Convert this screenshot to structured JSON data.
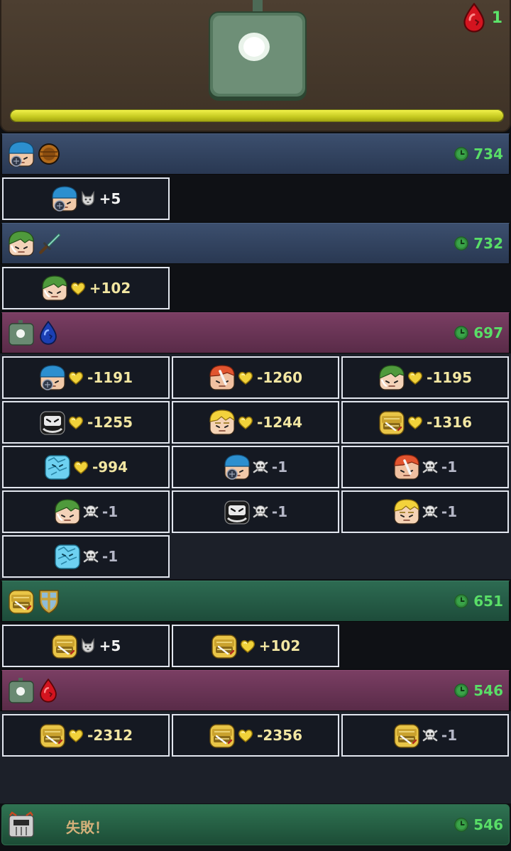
{
  "boss": {
    "hp_fraction": 1.0,
    "count": "1",
    "count_icon": "red-drop-icon"
  },
  "turns": [
    {
      "id": "t1",
      "time": "734",
      "actor": "blue-hero",
      "skill": "round-shield-icon",
      "cells": [
        {
          "icon": "blue-hero",
          "effect": "wolf-icon",
          "value": "+5"
        }
      ]
    },
    {
      "id": "t2",
      "time": "732",
      "actor": "green-hero",
      "skill": "dagger-icon",
      "cells": [
        {
          "icon": "green-hero",
          "effect": "heart-icon",
          "value": "+102"
        }
      ]
    },
    {
      "id": "t3",
      "time": "697",
      "actor": "boss-tank",
      "skill": "blue-drop-icon",
      "cells": [
        {
          "icon": "blue-hero",
          "effect": "heart-icon",
          "value": "-1191"
        },
        {
          "icon": "red-hero",
          "effect": "heart-icon",
          "value": "-1260"
        },
        {
          "icon": "green-hero",
          "effect": "heart-icon",
          "value": "-1195"
        },
        {
          "icon": "black-hero",
          "effect": "heart-icon",
          "value": "-1255"
        },
        {
          "icon": "blonde-hero",
          "effect": "heart-icon",
          "value": "-1244"
        },
        {
          "icon": "gold-knight",
          "effect": "heart-icon",
          "value": "-1316"
        },
        {
          "icon": "ice-golem",
          "effect": "heart-icon",
          "value": "-994"
        },
        {
          "icon": "blue-hero",
          "effect": "skull-icon",
          "value": "-1"
        },
        {
          "icon": "red-hero",
          "effect": "skull-icon",
          "value": "-1"
        },
        {
          "icon": "green-hero",
          "effect": "skull-icon",
          "value": "-1"
        },
        {
          "icon": "black-hero",
          "effect": "skull-icon",
          "value": "-1"
        },
        {
          "icon": "blonde-hero",
          "effect": "skull-icon",
          "value": "-1"
        },
        {
          "icon": "ice-golem",
          "effect": "skull-icon",
          "value": "-1"
        }
      ]
    },
    {
      "id": "t4",
      "time": "651",
      "actor": "gold-knight",
      "skill": "cross-shield-icon",
      "cells": [
        {
          "icon": "gold-knight",
          "effect": "wolf-icon",
          "value": "+5"
        },
        {
          "icon": "gold-knight",
          "effect": "heart-icon",
          "value": "+102"
        }
      ]
    },
    {
      "id": "t5",
      "time": "546",
      "actor": "boss-tank",
      "skill": "red-drop-icon",
      "cells": [
        {
          "icon": "gold-knight",
          "effect": "heart-icon",
          "value": "-2312"
        },
        {
          "icon": "gold-knight",
          "effect": "heart-icon",
          "value": "-2356"
        },
        {
          "icon": "gold-knight",
          "effect": "skull-icon",
          "value": "-1"
        }
      ]
    }
  ],
  "result": {
    "text": "失敗！",
    "time": "546",
    "actor": "helmet-knight"
  },
  "colors": {
    "time_green": "#59de67",
    "hp_yellow": "#d9dc26"
  }
}
